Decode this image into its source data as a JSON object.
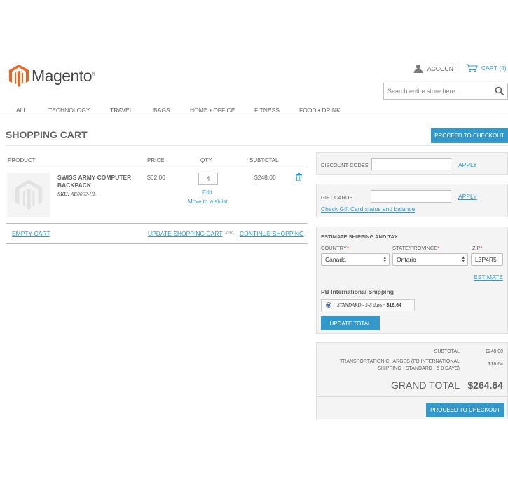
{
  "header": {
    "logo_text": "Magento",
    "account_label": "ACCOUNT",
    "cart_label": "CART (4)",
    "search_placeholder": "Search entire store here..."
  },
  "nav": [
    "ALL",
    "TECHNOLOGY",
    "TRAVEL",
    "BAGS",
    "HOME • OFFICE",
    "FITNESS",
    "FOOD • DRINK"
  ],
  "page": {
    "title": "SHOPPING CART",
    "checkout_button": "PROCEED TO CHECKOUT"
  },
  "cart_table": {
    "columns": [
      "PRODUCT",
      "PRICE",
      "QTY",
      "SUBTOTAL"
    ],
    "items": [
      {
        "name": "SWISS ARMY COMPUTER BACKPACK",
        "sku_label": "SKU:",
        "sku": "AE0062-HL",
        "price": "$62.00",
        "qty": "4",
        "subtotal": "$248.00",
        "edit_label": "Edit",
        "wishlist_label": "Move to wishlist"
      }
    ],
    "empty_cart": "EMPTY CART",
    "update_cart": "UPDATE SHOPPING CART",
    "or": "-OR-",
    "continue_shopping": "CONTINUE SHOPPING"
  },
  "discount": {
    "label": "DISCOUNT CODES",
    "value": "",
    "apply": "APPLY"
  },
  "gift_cards": {
    "label": "GIFT CARDS",
    "value": "",
    "apply": "APPLY",
    "check_link": "Check Gift Card status and balance"
  },
  "estimate": {
    "title": "ESTIMATE SHIPPING AND TAX",
    "country_label": "COUNTRY",
    "country_value": "Canada",
    "state_label": "STATE/PROVINCE",
    "state_value": "Ontario",
    "zip_label": "ZIP",
    "zip_value": "L3P4R5",
    "required_mark": "*",
    "estimate_link": "ESTIMATE",
    "method_title": "PB International Shipping",
    "method_option": "STANDARD - 5-8 days",
    "method_price": "$16.64",
    "update_total": "UPDATE TOTAL"
  },
  "totals": {
    "subtotal_label": "SUBTOTAL",
    "subtotal_value": "$248.00",
    "transport_label": "TRANSPORTATION CHARGES (PB INTERNATIONAL SHIPPING - STANDARD - 5-8 DAYS)",
    "transport_value": "$16.64",
    "grand_label": "GRAND TOTAL",
    "grand_value": "$264.64",
    "checkout_button": "PROCEED TO CHECKOUT"
  },
  "colors": {
    "accent": "#3399cc",
    "logo_orange": "#f26322",
    "text": "#636363",
    "panel": "#f4f4f4"
  }
}
